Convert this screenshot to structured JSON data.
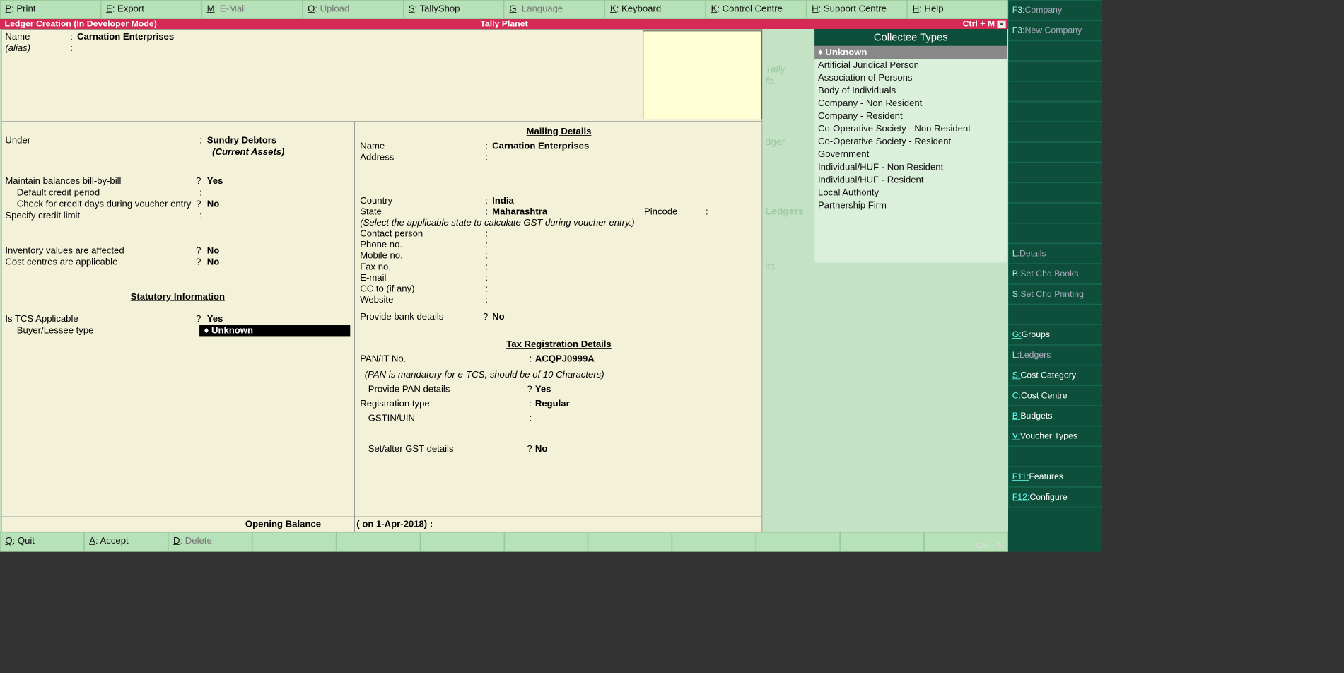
{
  "top_menu": [
    {
      "key": "P",
      "label": "Print",
      "active": true
    },
    {
      "key": "E",
      "label": "Export",
      "active": true
    },
    {
      "key": "M",
      "label": "E-Mail",
      "active": false
    },
    {
      "key": "O",
      "label": "Upload",
      "active": false
    },
    {
      "key": "S",
      "label": "TallyShop",
      "active": true
    },
    {
      "key": "G",
      "label": "Language",
      "active": false
    },
    {
      "key": "K",
      "label": "Keyboard",
      "active": true
    },
    {
      "key": "K",
      "label": "Control Centre",
      "active": true
    },
    {
      "key": "H",
      "label": "Support Centre",
      "active": true
    },
    {
      "key": "H",
      "label": "Help",
      "active": true
    }
  ],
  "red_bar": {
    "left": "Ledger Creation (In Developer Mode)",
    "center": "Tally Planet",
    "right": "Ctrl + M"
  },
  "form": {
    "name_lbl": "Name",
    "name_val": "Carnation Enterprises",
    "alias_lbl": "(alias)",
    "under_lbl": "Under",
    "under_val": "Sundry Debtors",
    "under_sub": "(Current Assets)",
    "maintain_lbl": "Maintain balances bill-by-bill",
    "maintain_val": "Yes",
    "def_credit_lbl": "Default credit period",
    "def_credit_val": "",
    "check_credit_lbl": "Check for credit days during voucher entry",
    "check_credit_val": "No",
    "spec_limit_lbl": "Specify credit limit",
    "spec_limit_val": "",
    "inv_lbl": "Inventory values are affected",
    "inv_val": "No",
    "cost_lbl": "Cost centres are applicable",
    "cost_val": "No",
    "stat_title": "Statutory Information",
    "tcs_lbl": "Is TCS Applicable",
    "tcs_val": "Yes",
    "buyer_lbl": "Buyer/Lessee type",
    "buyer_val": "♦ Unknown"
  },
  "mailing": {
    "title": "Mailing Details",
    "name_lbl": "Name",
    "name_val": "Carnation Enterprises",
    "addr_lbl": "Address",
    "addr_val": "",
    "country_lbl": "Country",
    "country_val": "India",
    "state_lbl": "State",
    "state_val": "Maharashtra",
    "pin_lbl": "Pincode",
    "pin_val": "",
    "state_note": "(Select the applicable state to calculate GST during voucher entry.)",
    "contact_lbl": "Contact person",
    "phone_lbl": "Phone no.",
    "mobile_lbl": "Mobile no.",
    "fax_lbl": "Fax no.",
    "email_lbl": "E-mail",
    "cc_lbl": "CC to (if any)",
    "web_lbl": "Website",
    "bank_lbl": "Provide bank details",
    "bank_val": "No"
  },
  "tax": {
    "title": "Tax Registration Details",
    "pan_lbl": "PAN/IT No.",
    "pan_val": "ACQPJ0999A",
    "pan_note": "(PAN is mandatory for e-TCS, should be of 10 Characters)",
    "provide_pan_lbl": "Provide PAN details",
    "provide_pan_val": "Yes",
    "reg_lbl": "Registration type",
    "reg_val": "Regular",
    "gstin_lbl": "GSTIN/UIN",
    "gstin_val": "",
    "setalter_lbl": "Set/alter GST details",
    "setalter_val": "No"
  },
  "opening": {
    "lbl": "Opening Balance",
    "date": "( on 1-Apr-2018)  :"
  },
  "collectee": {
    "title": "Collectee Types",
    "items": [
      "Unknown",
      "Artificial Juridical Person",
      "Association of Persons",
      "Body of Individuals",
      "Company - Non Resident",
      "Company - Resident",
      "Co-Operative Society - Non Resident",
      "Co-Operative Society - Resident",
      "Government",
      "Individual/HUF - Non Resident",
      "Individual/HUF - Resident",
      "Local Authority",
      "Partnership Firm"
    ],
    "selected": 0
  },
  "bg_hints": {
    "a": "Tally",
    "b": "fo.",
    "c": "dger",
    "d": "Ledgers",
    "e": "lts"
  },
  "bottom_menu": [
    {
      "key": "Q",
      "label": "Quit",
      "active": true
    },
    {
      "key": "A",
      "label": "Accept",
      "active": true
    },
    {
      "key": "D",
      "label": "Delete",
      "active": false
    },
    {
      "key": "",
      "label": ""
    },
    {
      "key": "",
      "label": ""
    },
    {
      "key": "",
      "label": ""
    },
    {
      "key": "",
      "label": ""
    },
    {
      "key": "",
      "label": ""
    },
    {
      "key": "",
      "label": ""
    },
    {
      "key": "",
      "label": ""
    },
    {
      "key": "",
      "label": ""
    },
    {
      "key": "",
      "label": ""
    }
  ],
  "ctrl_n": "Ctrl + N",
  "side": [
    {
      "k": "F3:",
      "t": "Company",
      "active": false
    },
    {
      "k": "F3:",
      "t": "New Company",
      "active": false
    },
    {
      "k": "",
      "t": "",
      "spacer": true
    },
    {
      "k": "",
      "t": "",
      "spacer": true
    },
    {
      "k": "",
      "t": "",
      "spacer": true
    },
    {
      "k": "",
      "t": "",
      "spacer": true
    },
    {
      "k": "",
      "t": "",
      "spacer": true
    },
    {
      "k": "",
      "t": "",
      "spacer": true
    },
    {
      "k": "",
      "t": "",
      "spacer": true
    },
    {
      "k": "",
      "t": "",
      "spacer": true
    },
    {
      "k": "",
      "t": "",
      "spacer": true
    },
    {
      "k": "",
      "t": "",
      "spacer": true
    },
    {
      "k": "L:",
      "t": "Details",
      "active": false
    },
    {
      "k": "B:",
      "t": "Set Chq Books",
      "active": false
    },
    {
      "k": "S:",
      "t": "Set Chq Printing",
      "active": false
    },
    {
      "k": "",
      "t": "",
      "spacer": true
    },
    {
      "k": "G:",
      "t": "Groups",
      "active": true
    },
    {
      "k": "L:",
      "t": "Ledgers",
      "active": false
    },
    {
      "k": "S:",
      "t": "Cost Category",
      "active": true
    },
    {
      "k": "C:",
      "t": "Cost Centre",
      "active": true
    },
    {
      "k": "B:",
      "t": "Budgets",
      "active": true
    },
    {
      "k": "V:",
      "t": "Voucher Types",
      "active": true
    },
    {
      "k": "",
      "t": "",
      "spacer": true
    },
    {
      "k": "F11:",
      "t": "Features",
      "active": true
    },
    {
      "k": "F12:",
      "t": "Configure",
      "active": true
    }
  ]
}
